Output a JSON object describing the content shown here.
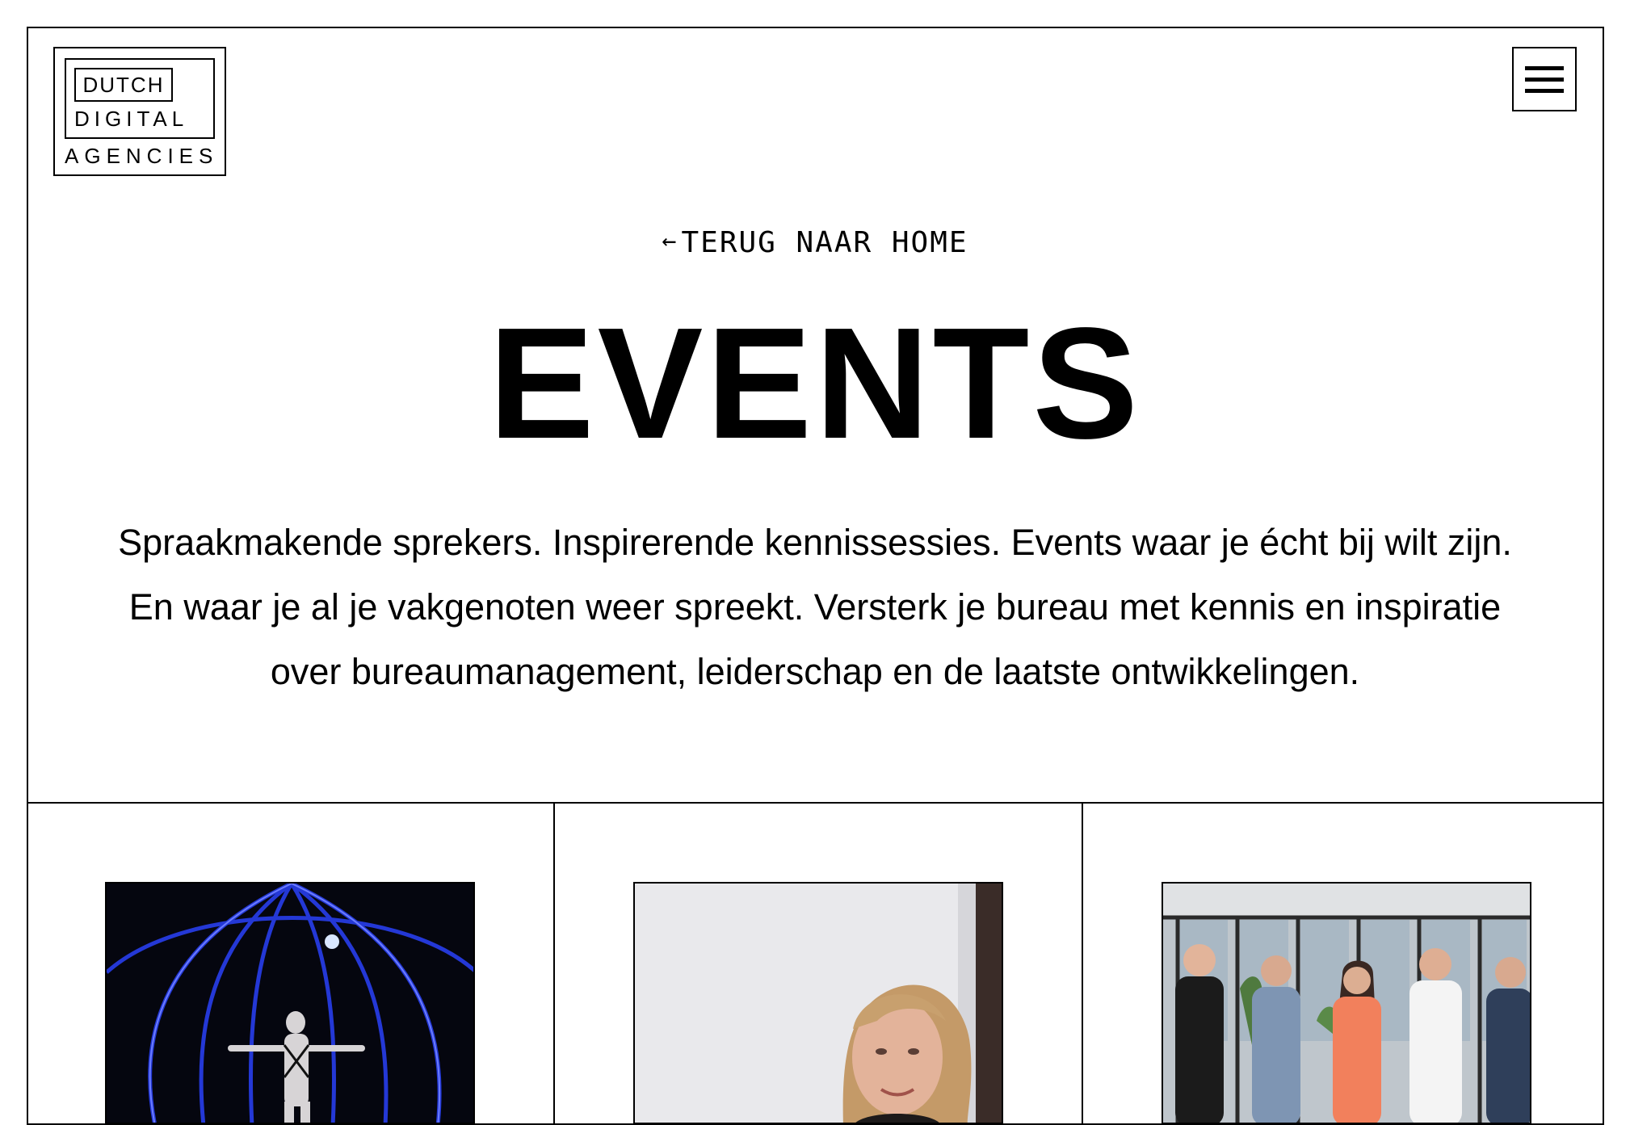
{
  "logo": {
    "line1": "DUTCH",
    "line2": "DIGITAL",
    "line3": "AGENCIES"
  },
  "menu": {
    "icon": "hamburger-menu-icon"
  },
  "back_link": {
    "arrow": "←",
    "label": "TERUG NAAR HOME"
  },
  "page": {
    "title": "EVENTS",
    "intro": "Spraakmakende sprekers. Inspirerende kennissessies. Events waar je écht bij wilt zijn. En waar je al je vakgenoten weer spreekt. Versterk je bureau met kennis en inspiratie over bureaumanagement, leiderschap en de laatste ontwikkelingen."
  },
  "cards": [
    {
      "image": "performer-in-blue-light-cage-photo"
    },
    {
      "image": "woman-portrait-photo"
    },
    {
      "image": "team-group-office-photo"
    }
  ],
  "colors": {
    "text": "#000000",
    "background": "#ffffff",
    "border": "#000000"
  }
}
